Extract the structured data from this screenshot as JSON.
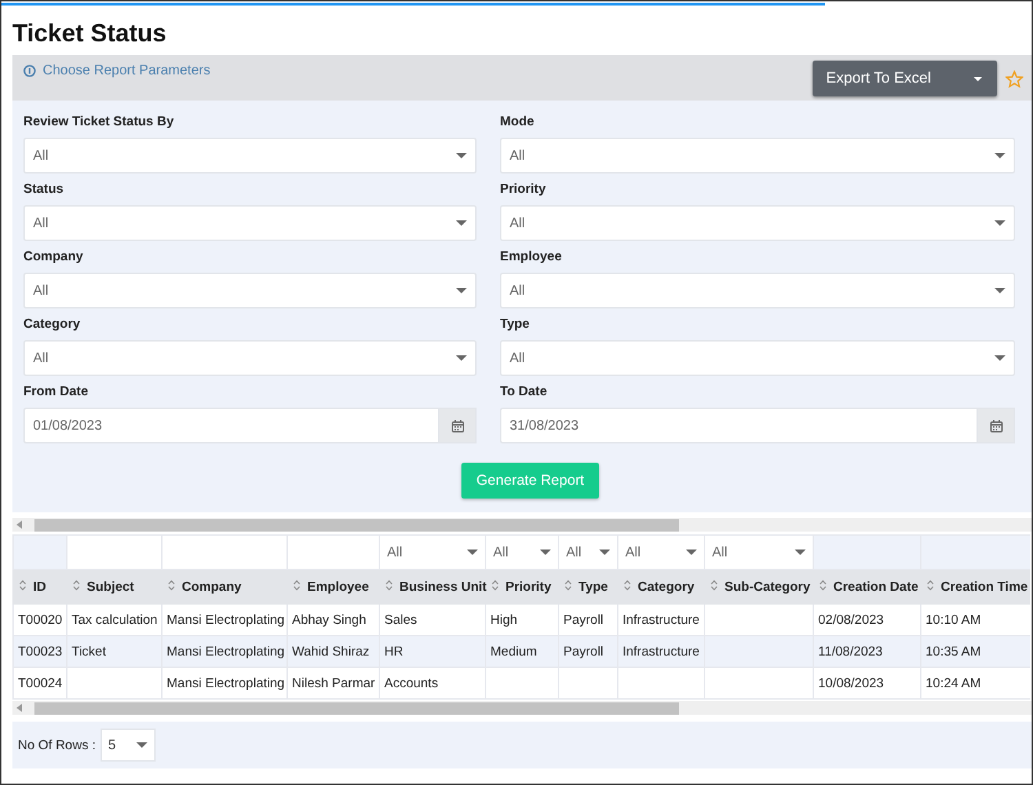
{
  "title": "Ticket Status",
  "toolbar": {
    "link": "Choose Report Parameters",
    "export_button": "Export To Excel",
    "starred": false
  },
  "filters": [
    {
      "label": "Review Ticket Status By",
      "value": "All",
      "kind": "select"
    },
    {
      "label": "Mode",
      "value": "All",
      "kind": "select"
    },
    {
      "label": "Status",
      "value": "All",
      "kind": "select"
    },
    {
      "label": "Priority",
      "value": "All",
      "kind": "select"
    },
    {
      "label": "Company",
      "value": "All",
      "kind": "select"
    },
    {
      "label": "Employee",
      "value": "All",
      "kind": "select"
    },
    {
      "label": "Category",
      "value": "All",
      "kind": "select"
    },
    {
      "label": "Type",
      "value": "All",
      "kind": "select"
    },
    {
      "label": "From Date",
      "value": "01/08/2023",
      "kind": "date"
    },
    {
      "label": "To Date",
      "value": "31/08/2023",
      "kind": "date"
    }
  ],
  "generate_button": "Generate Report",
  "table": {
    "columns": [
      {
        "label": "ID"
      },
      {
        "label": "Subject"
      },
      {
        "label": "Company"
      },
      {
        "label": "Employee"
      },
      {
        "label": "Business Unit",
        "filter": "All"
      },
      {
        "label": "Priority",
        "filter": "All"
      },
      {
        "label": "Type",
        "filter": "All"
      },
      {
        "label": "Category",
        "filter": "All"
      },
      {
        "label": "Sub-Category",
        "filter": "All"
      },
      {
        "label": "Creation Date"
      },
      {
        "label": "Creation Time"
      }
    ],
    "rows": [
      [
        "T00020",
        "Tax calculation",
        "Mansi Electroplating",
        "Abhay Singh",
        "Sales",
        "High",
        "Payroll",
        "Infrastructure",
        null,
        "02/08/2023",
        "10:10 AM"
      ],
      [
        "T00023",
        "Ticket",
        "Mansi Electroplating",
        "Wahid Shiraz",
        "HR",
        "Medium",
        "Payroll",
        "Infrastructure",
        null,
        "11/08/2023",
        "10:35 AM"
      ],
      [
        "T00024",
        null,
        "Mansi Electroplating",
        "Nilesh Parmar",
        "Accounts",
        null,
        null,
        null,
        null,
        "10/08/2023",
        "10:24 AM"
      ]
    ]
  },
  "footer": {
    "label": "No Of Rows :",
    "value": "5"
  }
}
